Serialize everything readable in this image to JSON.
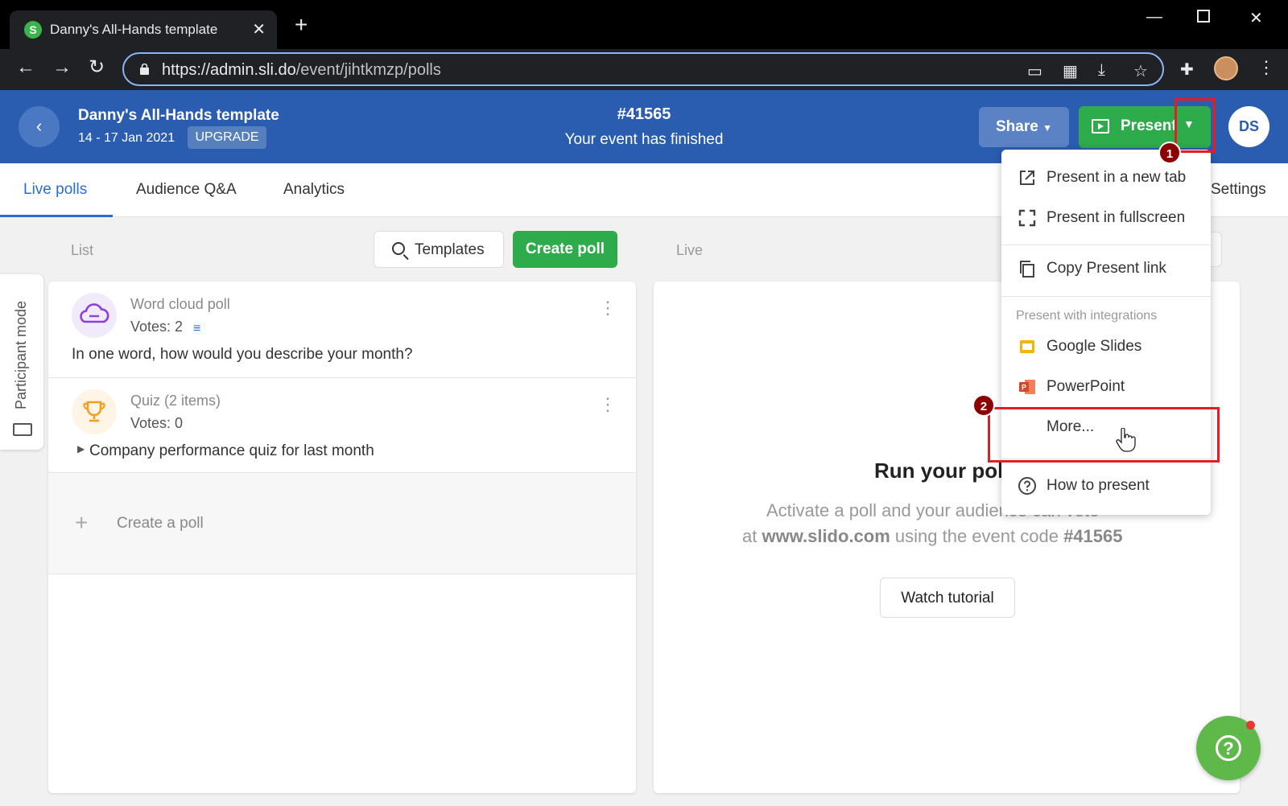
{
  "browser": {
    "tab_title": "Danny's All-Hands template",
    "favicon_letter": "S",
    "url_host": "https://admin.sli.do",
    "url_path": "/event/jihtkmzp/polls"
  },
  "header": {
    "event_title": "Danny's All-Hands template",
    "dates": "14 - 17 Jan 2021",
    "upgrade_label": "UPGRADE",
    "event_code": "#41565",
    "status": "Your event has finished",
    "share_label": "Share",
    "present_label": "Present",
    "avatar_initials": "DS"
  },
  "tabs": {
    "live_polls": "Live polls",
    "audience_qa": "Audience Q&A",
    "analytics": "Analytics",
    "settings": "Settings"
  },
  "list": {
    "label": "List",
    "templates_label": "Templates",
    "create_poll_label": "Create poll",
    "live_label": "Live",
    "participant_mode": "Participant mode",
    "polls": [
      {
        "type": "Word cloud poll",
        "votes": "Votes: 2",
        "question": "In one word, how would you describe your month?",
        "icon": "cloud-icon"
      },
      {
        "type": "Quiz (2 items)",
        "votes": "Votes: 0",
        "question": "Company performance quiz for last month",
        "icon": "trophy-icon"
      }
    ],
    "create_a_poll": "Create a poll"
  },
  "live": {
    "title": "Run your poll",
    "desc_line1": "Activate a poll and your audience can vote",
    "desc_at": "at ",
    "desc_site": "www.slido.com",
    "desc_mid": " using the event code ",
    "desc_code": "#41565",
    "watch_tutorial": "Watch tutorial"
  },
  "present_menu": {
    "new_tab": "Present in a new tab",
    "fullscreen": "Present in fullscreen",
    "copy_link": "Copy Present link",
    "integrations_heading": "Present with integrations",
    "google_slides": "Google Slides",
    "powerpoint": "PowerPoint",
    "more": "More...",
    "how_to_present": "How to present"
  },
  "annotations": {
    "marker_1": "1",
    "marker_2": "2",
    "highlight_color": "#e01e24"
  },
  "colors": {
    "header_blue": "#2a5db0",
    "present_green": "#2eab4a",
    "active_tab_blue": "#2a6cd6"
  }
}
